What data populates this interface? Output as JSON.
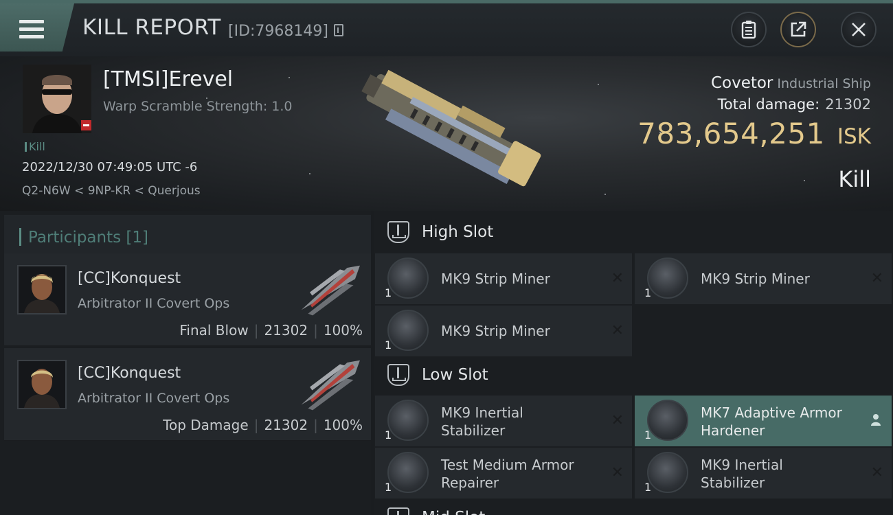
{
  "header": {
    "title": "KILL REPORT",
    "kill_id": "[ID:7968149]"
  },
  "victim": {
    "name": "[TMSI]Erevel",
    "warp_scramble": "Warp Scramble Strength: 1.0",
    "tag": "Kill",
    "datetime": "2022/12/30 07:49:05 UTC -6",
    "location": "Q2-N6W < 9NP-KR < Querjous",
    "ship_name": "Covetor",
    "ship_class": "Industrial Ship",
    "total_damage_label": "Total damage:",
    "total_damage": "21302",
    "isk_value": "783,654,251",
    "isk_unit": "ISK",
    "result": "Kill"
  },
  "participants": {
    "title": "Participants [1]",
    "cards": [
      {
        "name": "[CC]Konquest",
        "ship": "Arbitrator II Covert Ops",
        "role": "Final Blow",
        "damage": "21302",
        "percent": "100%"
      },
      {
        "name": "[CC]Konquest",
        "ship": "Arbitrator II Covert Ops",
        "role": "Top Damage",
        "damage": "21302",
        "percent": "100%"
      }
    ]
  },
  "fittings": {
    "high_slot": {
      "title": "High Slot",
      "modules": [
        {
          "qty": "1",
          "name": "MK9 Strip Miner"
        },
        {
          "qty": "1",
          "name": "MK9 Strip Miner"
        },
        {
          "qty": "1",
          "name": "MK9 Strip Miner"
        }
      ]
    },
    "low_slot": {
      "title": "Low Slot",
      "modules": [
        {
          "qty": "1",
          "name1": "MK9 Inertial",
          "name2": "Stabilizer"
        },
        {
          "qty": "1",
          "name1": "MK7 Adaptive Armor",
          "name2": "Hardener"
        },
        {
          "qty": "1",
          "name1": "Test Medium Armor",
          "name2": "Repairer"
        },
        {
          "qty": "1",
          "name1": "MK9 Inertial",
          "name2": "Stabilizer"
        }
      ]
    },
    "mid_slot_partial": "Mid Slot"
  },
  "colors": {
    "accent_teal": "#4a6a66",
    "isk_gold": "#e3c98c",
    "highlight_row": "#476b66"
  },
  "icons": {
    "menu": "hamburger-icon",
    "notes": "clipboard-icon",
    "share": "share-icon",
    "close": "close-icon"
  }
}
